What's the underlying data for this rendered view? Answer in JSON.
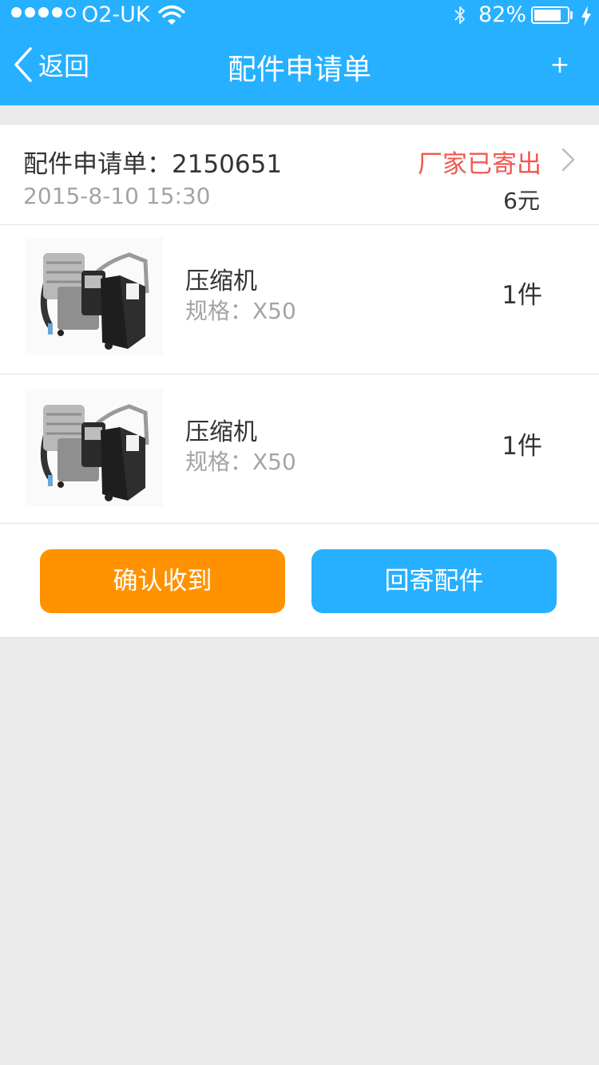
{
  "status_bar": {
    "carrier": "O2-UK",
    "battery_percent": "82%",
    "battery_level": 0.82,
    "signal_bars": 4
  },
  "nav": {
    "back_label": "返回",
    "title": "配件申请单",
    "plus_label": "+"
  },
  "order": {
    "label": "配件申请单：2150651",
    "status": "厂家已寄出",
    "date": "2015-8-10  15:30",
    "price": "6元"
  },
  "items": [
    {
      "name": "压缩机",
      "spec": "规格：X50",
      "qty": "1件"
    },
    {
      "name": "压缩机",
      "spec": "规格：X50",
      "qty": "1件"
    }
  ],
  "actions": {
    "confirm_label": "确认收到",
    "return_label": "回寄配件"
  },
  "colors": {
    "nav_bg": "#26b0ff",
    "status_red": "#f0574e",
    "confirm_orange": "#ff9200",
    "return_blue": "#26b0ff"
  },
  "icons": [
    "signal-dots-icon",
    "wifi-icon",
    "bluetooth-icon",
    "battery-icon",
    "charging-bolt-icon",
    "back-chevron-icon",
    "chevron-right-icon",
    "air-compressor-image"
  ]
}
